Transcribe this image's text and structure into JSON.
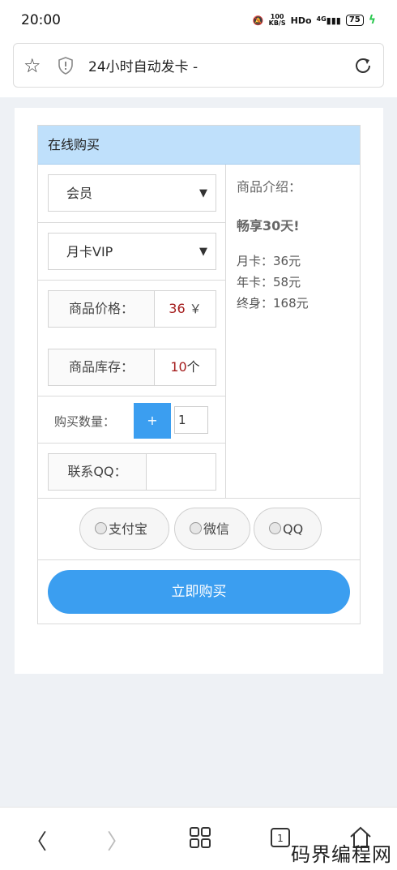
{
  "status_bar": {
    "time": "20:00",
    "net_speed_top": "100",
    "net_speed_bottom": "KB/S",
    "hd": "HDo",
    "signal": "4G",
    "battery": "75"
  },
  "browser": {
    "page_title": "24小时自动发卡 -"
  },
  "panel": {
    "title": "在线购买",
    "category_select": "会员",
    "product_select": "月卡VIP",
    "price_label": "商品价格：",
    "price_value": "36",
    "price_unit": "￥",
    "stock_label": "商品库存：",
    "stock_value": "10",
    "stock_unit": "个",
    "quantity_label": "购买数量：",
    "plus_label": "+",
    "quantity_value": "1",
    "qq_label": "联系QQ："
  },
  "intro": {
    "heading": "商品介绍：",
    "highlight": "畅享30天!",
    "lines": [
      "月卡：36元",
      "年卡：58元",
      "终身：168元"
    ]
  },
  "payment": {
    "options": [
      "支付宝",
      "微信",
      "QQ"
    ]
  },
  "buy_button": "立即购买",
  "watermark": "码界编程网",
  "colors": {
    "accent": "#3b9ef0",
    "header_bg": "#bfe0fb",
    "price_red": "#a51d1d"
  }
}
